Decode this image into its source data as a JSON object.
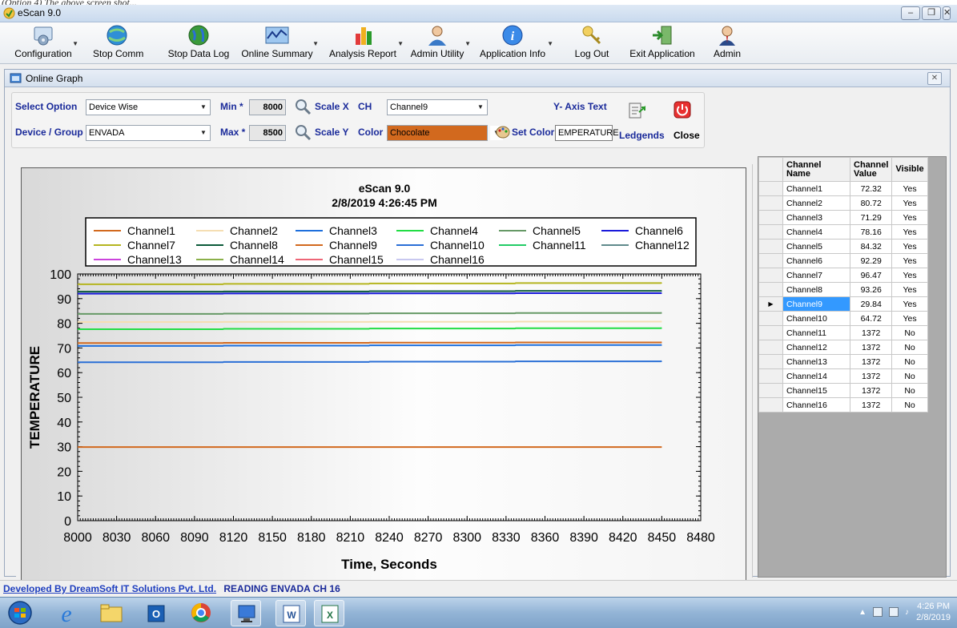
{
  "window": {
    "title": "eScan 9.0",
    "cut_text": "(Option 4) The above screen shot..."
  },
  "toolbar": {
    "items": [
      {
        "label": "Configuration"
      },
      {
        "label": "Stop Comm"
      },
      {
        "label": "Stop Data Log"
      },
      {
        "label": "Online Summary"
      },
      {
        "label": "Analysis Report"
      },
      {
        "label": "Admin Utility"
      },
      {
        "label": "Application Info"
      },
      {
        "label": "Log Out"
      },
      {
        "label": "Exit Application"
      },
      {
        "label": "Admin"
      }
    ]
  },
  "child": {
    "title": "Online Graph"
  },
  "options": {
    "select_option_label": "Select Option",
    "select_option_value": "Device Wise",
    "device_group_label": "Device / Group",
    "device_group_value": "ENVADA",
    "min_label": "Min *",
    "min_value": "8000",
    "max_label": "Max *",
    "max_value": "8500",
    "scale_x_label": "Scale X",
    "scale_y_label": "Scale Y",
    "ch_label": "CH",
    "ch_value": "Channel9",
    "color_label": "Color",
    "color_value": "Chocolate",
    "color_hex": "#d2691e",
    "set_color_label": "Set Color",
    "y_axis_text_label": "Y- Axis Text",
    "y_axis_text_value": "EMPERATURE",
    "legends_label": "Ledgends",
    "close_label": "Close"
  },
  "grid": {
    "headers": [
      "Channel Name",
      "Channel Value",
      "Visible"
    ],
    "rows": [
      {
        "name": "Channel1",
        "value": "72.32",
        "visible": "Yes"
      },
      {
        "name": "Channel2",
        "value": "80.72",
        "visible": "Yes"
      },
      {
        "name": "Channel3",
        "value": "71.29",
        "visible": "Yes"
      },
      {
        "name": "Channel4",
        "value": "78.16",
        "visible": "Yes"
      },
      {
        "name": "Channel5",
        "value": "84.32",
        "visible": "Yes"
      },
      {
        "name": "Channel6",
        "value": "92.29",
        "visible": "Yes"
      },
      {
        "name": "Channel7",
        "value": "96.47",
        "visible": "Yes"
      },
      {
        "name": "Channel8",
        "value": "93.26",
        "visible": "Yes"
      },
      {
        "name": "Channel9",
        "value": "29.84",
        "visible": "Yes"
      },
      {
        "name": "Channel10",
        "value": "64.72",
        "visible": "Yes"
      },
      {
        "name": "Channel11",
        "value": "1372",
        "visible": "No"
      },
      {
        "name": "Channel12",
        "value": "1372",
        "visible": "No"
      },
      {
        "name": "Channel13",
        "value": "1372",
        "visible": "No"
      },
      {
        "name": "Channel14",
        "value": "1372",
        "visible": "No"
      },
      {
        "name": "Channel15",
        "value": "1372",
        "visible": "No"
      },
      {
        "name": "Channel16",
        "value": "1372",
        "visible": "No"
      }
    ],
    "selected_row": 8
  },
  "status": {
    "developer_link": "Developed By DreamSoft IT Solutions Pvt. Ltd.",
    "status_text": "READING ENVADA CH 16"
  },
  "taskbar": {
    "apps": [
      "start-orb",
      "internet-explorer",
      "file-explorer",
      "outlook",
      "chrome",
      "escan-app",
      "word",
      "excel"
    ],
    "clock_time": "4:26 PM",
    "clock_date": "2/8/2019"
  },
  "chart_data": {
    "type": "line",
    "title": "eScan 9.0",
    "subtitle": "2/8/2019 4:26:45 PM",
    "xlabel": "Time, Seconds",
    "ylabel": "TEMPERATURE",
    "xlim": [
      8000,
      8480
    ],
    "ylim": [
      0,
      100
    ],
    "xticks": [
      8000,
      8030,
      8060,
      8090,
      8120,
      8150,
      8180,
      8210,
      8240,
      8270,
      8300,
      8330,
      8360,
      8390,
      8420,
      8450,
      8480
    ],
    "yticks": [
      0,
      10,
      20,
      30,
      40,
      50,
      60,
      70,
      80,
      90,
      100
    ],
    "x_end": 8450,
    "legend_position": "top",
    "series": [
      {
        "name": "Channel1",
        "color": "#d2691e",
        "values": [
          72.0,
          72.32
        ]
      },
      {
        "name": "Channel2",
        "color": "#f5deb3",
        "values": [
          80.5,
          80.72
        ]
      },
      {
        "name": "Channel3",
        "color": "#1e6fdc",
        "values": [
          70.8,
          71.29
        ]
      },
      {
        "name": "Channel4",
        "color": "#22dd44",
        "values": [
          77.6,
          78.16
        ]
      },
      {
        "name": "Channel5",
        "color": "#669966",
        "values": [
          83.8,
          84.32
        ]
      },
      {
        "name": "Channel6",
        "color": "#1a1adb",
        "values": [
          92.0,
          92.29
        ]
      },
      {
        "name": "Channel7",
        "color": "#b5b520",
        "values": [
          95.8,
          96.47
        ]
      },
      {
        "name": "Channel8",
        "color": "#0b5a3a",
        "values": [
          92.8,
          93.26
        ]
      },
      {
        "name": "Channel9",
        "color": "#d2691e",
        "values": [
          29.84,
          29.84
        ]
      },
      {
        "name": "Channel10",
        "color": "#2a6fd6",
        "values": [
          64.2,
          64.72
        ]
      },
      {
        "name": "Channel11",
        "color": "#22cc66",
        "values": []
      },
      {
        "name": "Channel12",
        "color": "#5f8a8b",
        "values": []
      },
      {
        "name": "Channel13",
        "color": "#cc44dd",
        "values": []
      },
      {
        "name": "Channel14",
        "color": "#8bb04a",
        "values": []
      },
      {
        "name": "Channel15",
        "color": "#ee6677",
        "values": []
      },
      {
        "name": "Channel16",
        "color": "#c8c8f0",
        "values": []
      }
    ]
  }
}
